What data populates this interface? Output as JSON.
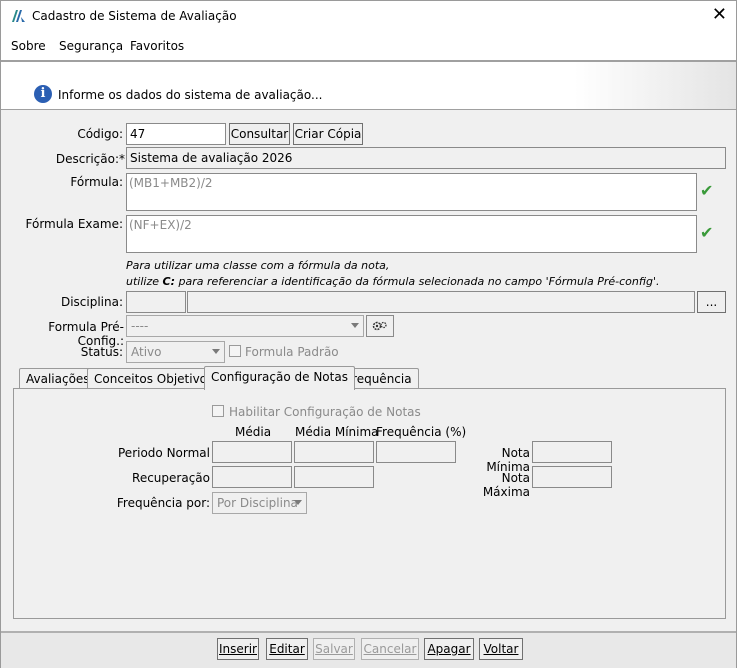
{
  "window": {
    "title": "Cadastro de Sistema de Avaliação",
    "close_glyph": "✕"
  },
  "menu": {
    "items": [
      "Sobre",
      "Segurança",
      "Favoritos"
    ]
  },
  "banner": {
    "message": "Informe os dados do sistema de avaliação..."
  },
  "form": {
    "codigo_label": "Código:",
    "codigo_value": "47",
    "consultar_label": "Consultar",
    "criar_copia_label": "Criar Cópia",
    "descricao_label": "Descrição:*",
    "descricao_value": "Sistema de avaliação 2026",
    "formula_label": "Fórmula:",
    "formula_value": "(MB1+MB2)/2",
    "formula_exame_label": "Fórmula Exame:",
    "formula_exame_value": "(NF+EX)/2",
    "note_line1": "Para utilizar uma classe com a fórmula da nota,",
    "note_line2_prefix": "utilize ",
    "note_line2_bold": "C:",
    "note_line2_suffix": " para referenciar a identificação da fórmula selecionada no campo 'Fórmula Pré-config'.",
    "disciplina_label": "Disciplina:",
    "disciplina_button": "...",
    "formula_preconfig_label": "Formula Pré-Config.:",
    "formula_preconfig_value": "----",
    "status_label": "Status:",
    "status_value": "Ativo",
    "formula_padrao_label": "Formula Padrão"
  },
  "tabs": [
    "Avaliações",
    "Conceitos Objetivos",
    "Configuração de Notas",
    "Frequência"
  ],
  "config_notas": {
    "habilitar_label": "Habilitar Configuração de Notas",
    "col_media": "Média",
    "col_media_minima": "Média Mínima",
    "col_frequencia": "Frequência (%)",
    "row_periodo": "Periodo Normal",
    "row_recuperacao": "Recuperação",
    "nota_minima_label": "Nota Mínima",
    "nota_maxima_label": "Nota Máxima",
    "frequencia_por_label": "Frequência por:",
    "frequencia_por_value": "Por Disciplina"
  },
  "footer": {
    "buttons": [
      "Inserir",
      "Editar",
      "Salvar",
      "Cancelar",
      "Apagar",
      "Voltar"
    ]
  },
  "colors": {
    "check": "#3a9a3a",
    "info_icon": "#2b5fb3"
  }
}
